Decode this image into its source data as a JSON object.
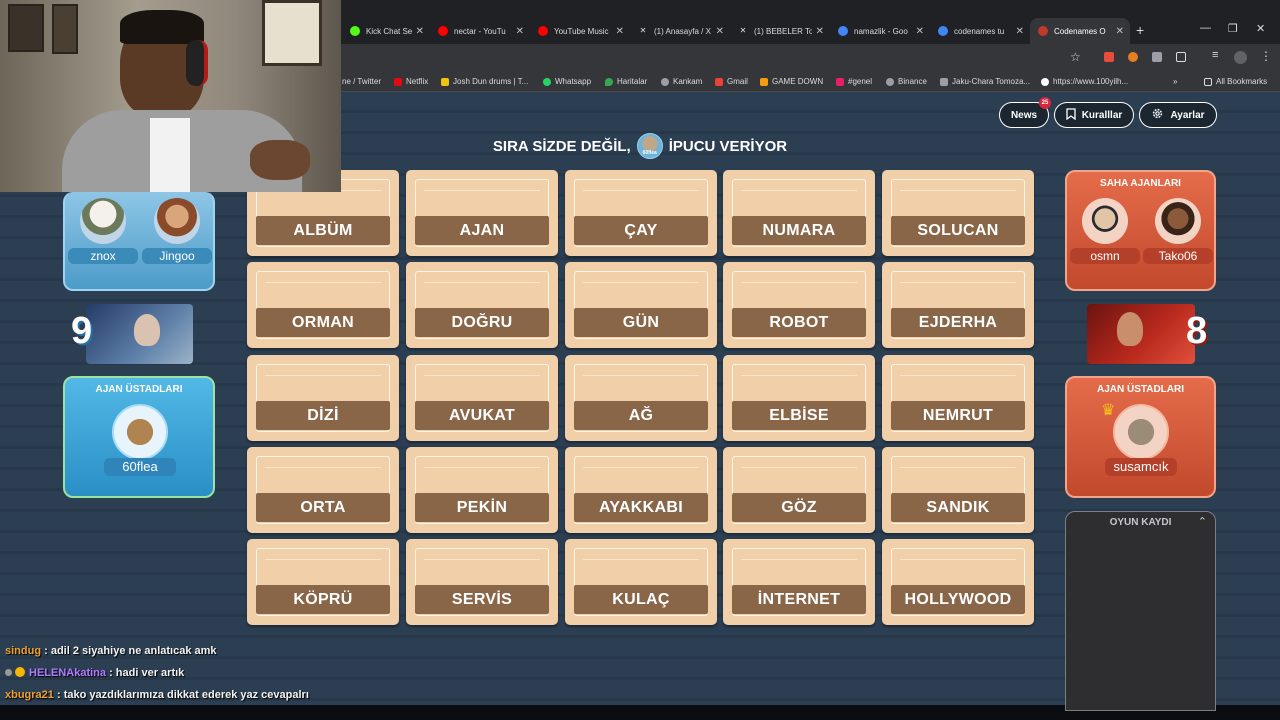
{
  "browser": {
    "tabs": [
      {
        "label": "Kick Chat Sear",
        "fav_color": "#53fc18"
      },
      {
        "label": "nectar - YouTu",
        "fav_color": "#ff0000"
      },
      {
        "label": "YouTube Music",
        "fav_color": "#ff0000"
      },
      {
        "label": "(1) Anasayfa / X",
        "fav_color": "#dddddd"
      },
      {
        "label": "(1) BEBELER To",
        "fav_color": "#dddddd"
      },
      {
        "label": "namazlik - Goo",
        "fav_color": "#4285f4"
      },
      {
        "label": "codenames tu",
        "fav_color": "#4285f4"
      },
      {
        "label": "Codenames O",
        "fav_color": "#c0392b"
      }
    ],
    "new_tab": "+",
    "bookmarks": [
      {
        "label": "ne / Twitter",
        "color": ""
      },
      {
        "label": "Netflix",
        "color": "#e50914"
      },
      {
        "label": "Josh Dun drums | T...",
        "color": "#f1c40f"
      },
      {
        "label": "Whatsapp",
        "color": "#25d366"
      },
      {
        "label": "Haritalar",
        "color": "#34a853"
      },
      {
        "label": "Kankam",
        "color": "#9aa0a6"
      },
      {
        "label": "Gmail",
        "color": "#ea4335"
      },
      {
        "label": "GAME DOWN",
        "color": "#f39c12"
      },
      {
        "label": "#genel",
        "color": "#e91e63"
      },
      {
        "label": "Binance",
        "color": "#9aa0a6"
      },
      {
        "label": "Jaku-Chara Tomoza...",
        "color": "#9aa0a6"
      },
      {
        "label": "https://www.100yilh...",
        "color": "#ffffff"
      }
    ],
    "all_bookmarks": "All Bookmarks"
  },
  "header": {
    "news_label": "News",
    "news_count": "25",
    "rules_label": "Kuralllar",
    "settings_label": "Ayarlar"
  },
  "status": {
    "text_before": "SIRA SİZDE DEĞİL,",
    "avatar_caption": "60flea",
    "text_after": "İPUCU VERİYOR"
  },
  "board": {
    "words": [
      "ALBÜM",
      "AJAN",
      "ÇAY",
      "NUMARA",
      "SOLUCAN",
      "ORMAN",
      "DOĞRU",
      "GÜN",
      "ROBOT",
      "EJDERHA",
      "DİZİ",
      "AVUKAT",
      "AĞ",
      "ELBİSE",
      "NEMRUT",
      "ORTA",
      "PEKİN",
      "AYAKKABI",
      "GÖZ",
      "SANDIK",
      "KÖPRÜ",
      "SERVİS",
      "KULAÇ",
      "İNTERNET",
      "HOLLYWOOD"
    ]
  },
  "blue_team": {
    "operatives": [
      {
        "name": "znox"
      },
      {
        "name": "Jingoo"
      }
    ],
    "score": "9",
    "spymaster_label": "AJAN ÜSTADLARI",
    "spymaster": "60flea",
    "color": "#3fa9dd"
  },
  "red_team": {
    "operatives_label": "SAHA AJANLARI",
    "operatives": [
      {
        "name": "osmn"
      },
      {
        "name": "Tako06"
      }
    ],
    "score": "8",
    "spymaster_label": "AJAN ÜSTADLARI",
    "spymaster": "susamcık",
    "color": "#d2583a"
  },
  "game_log": {
    "label": "OYUN KAYDI"
  },
  "chat": [
    {
      "user": "sindug",
      "user_color": "#f0a030",
      "text": " : adil 2 siyahiye ne anlatıcak amk"
    },
    {
      "user": "HELENAkatina",
      "user_color": "#b07cff",
      "text": " : hadi ver artık"
    },
    {
      "user": "xbugra21",
      "user_color": "#f0a030",
      "text": " : tako yazdıklarımıza dikkat ederek yaz cevapalrı"
    }
  ]
}
